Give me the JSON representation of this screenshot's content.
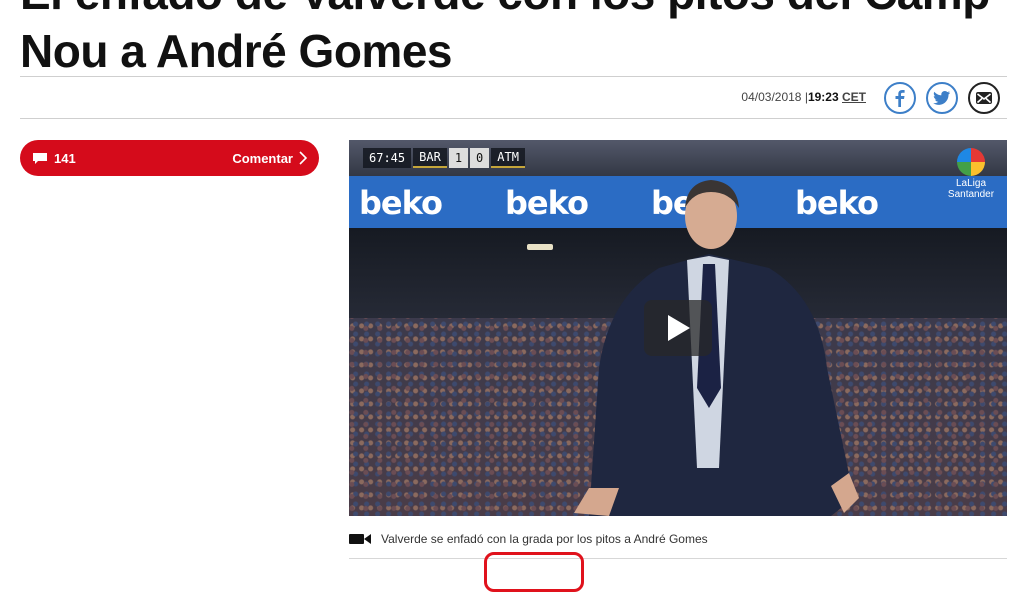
{
  "article": {
    "title": "El enfado de Valverde con los pitos del Camp Nou a André Gomes",
    "date": "04/03/2018",
    "separator": "|",
    "time": "19:23",
    "timezone": "CET"
  },
  "share": {
    "icons": [
      "facebook-icon",
      "twitter-icon",
      "email-icon"
    ]
  },
  "comments": {
    "count": "141",
    "label": "Comentar",
    "color": "#d50b1b"
  },
  "video": {
    "scorebug": {
      "clock": "67:45",
      "home": "BAR",
      "home_score": "1",
      "away_score": "0",
      "away": "ATM"
    },
    "league_logo_text": "LaLiga",
    "sponsor_text": "Santander",
    "ad_text": "beko",
    "caption": "Valverde se enfadó con la grada por los pitos a André Gomes"
  },
  "colors": {
    "banner": "#2b6cc4",
    "accent_red": "#d50b1b",
    "share_blue": "#3d7fc8"
  }
}
